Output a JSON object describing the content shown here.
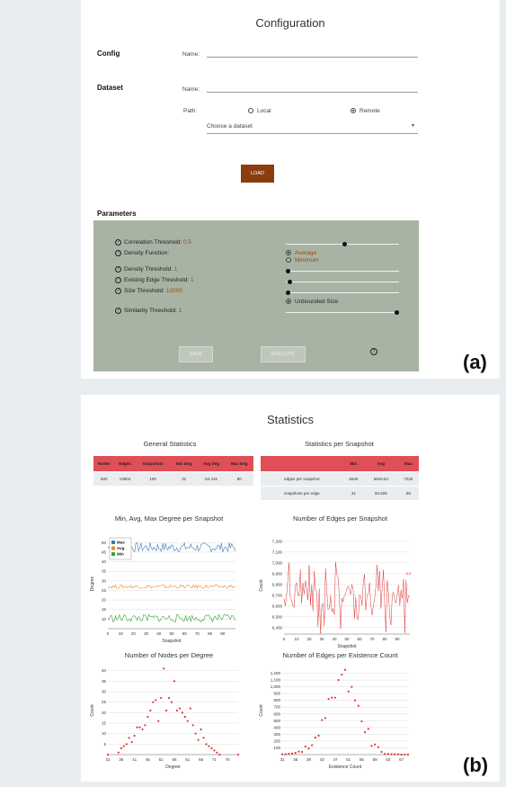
{
  "config": {
    "title": "Configuration",
    "config_label": "Config",
    "name_label": "Name:",
    "dataset_label": "Dataset",
    "dataset_name_label": "Name:",
    "path_label": "Path:",
    "local_label": "Local",
    "remote_label": "Remote",
    "dataset_select": "Choose a dataset",
    "load_label": "LOAD"
  },
  "parameters": {
    "title": "Parameters",
    "correlation_label": "Correlation Threshold: ",
    "correlation_value": "0.5",
    "density_fn_label": "Density Function:",
    "avg_label": "Average",
    "min_label": "Minimum",
    "density_label": "Density Threshold: ",
    "density_value": "1",
    "existing_label": "Existing Edge Threshold: ",
    "existing_value": "1",
    "size_label": "Size Threshold: ",
    "size_value": "10000",
    "unbounded_label": "Unbounded Size",
    "similarity_label": "Similarity Threshold: ",
    "similarity_value": "1",
    "save_label": "SAVE",
    "execute_label": "EXECUTE",
    "help_icon": "?",
    "correlation_slider": 0.52,
    "density_slider": 0.0,
    "existing_slider": 0.02,
    "size_slider": 0.0,
    "similarity_slider": 1.0
  },
  "labels": {
    "a": "(a)",
    "b": "(b)"
  },
  "stats": {
    "title": "Statistics",
    "general_title": "General Statistics",
    "snapshot_title": "Statistics per Snapshot",
    "general_headers": [
      "Nodes",
      "Edges",
      "Snapshots",
      "Min Deg",
      "Avg Deg",
      "Max Deg"
    ],
    "general_values": [
      "500",
      "13604",
      "100",
      "31",
      "54.416",
      "80"
    ],
    "snap_headers": [
      "",
      "Min",
      "Avg",
      "Max"
    ],
    "snap_rows": [
      [
        "edges per snapshot",
        "6845",
        "6843.54",
        "7226"
      ],
      [
        "snapshots per edge",
        "31",
        "50.505",
        "69"
      ]
    ]
  },
  "chart_data": [
    {
      "type": "line",
      "title": "Min, Avg, Max Degree per Snapshot",
      "xlabel": "Snapshot",
      "ylabel": "Degree",
      "xlim": [
        0,
        100
      ],
      "ylim": [
        5,
        52
      ],
      "xticks": [
        "0",
        "10",
        "20",
        "30",
        "40",
        "50",
        "60",
        "70",
        "80",
        "90"
      ],
      "yticks": [
        "10",
        "15",
        "20",
        "25",
        "30",
        "35",
        "40",
        "45",
        "50"
      ],
      "legend": "top-left",
      "colors": [
        "#3a78b5",
        "#ef8a2c",
        "#3aa23a"
      ],
      "series": [
        {
          "name": "Max",
          "base": 47.5,
          "amp": 2.5
        },
        {
          "name": "Avg",
          "base": 27,
          "amp": 1
        },
        {
          "name": "Min",
          "base": 10.5,
          "amp": 2
        }
      ]
    },
    {
      "type": "line",
      "title": "Number of Edges per Snapshot",
      "xlabel": "Snapshot",
      "ylabel": "Count",
      "xlim": [
        0,
        100
      ],
      "ylim": [
        6340,
        7240
      ],
      "xticks": [
        "0",
        "10",
        "20",
        "30",
        "40",
        "50",
        "60",
        "70",
        "80",
        "90"
      ],
      "yticks": [
        "6,400",
        "6,500",
        "6,600",
        "6,700",
        "6,800",
        "6,900",
        "7,000",
        "7,100",
        "7,200"
      ],
      "color": "#e03333",
      "annotation": "6,9"
    },
    {
      "type": "scatter",
      "title": "Number of Nodes per Degree",
      "xlabel": "Degree",
      "ylabel": "Count",
      "xlim": [
        31,
        80
      ],
      "ylim": [
        0,
        42
      ],
      "xticks": [
        "31",
        "36",
        "41",
        "46",
        "51",
        "56",
        "61",
        "66",
        "71",
        "76"
      ],
      "yticks": [
        "5",
        "10",
        "15",
        "20",
        "25",
        "30",
        "35",
        "40"
      ],
      "color": "#e03333",
      "x": [
        31,
        35,
        36,
        37,
        38,
        39,
        40,
        41,
        42,
        43,
        44,
        45,
        46,
        47,
        48,
        49,
        50,
        51,
        52,
        53,
        54,
        55,
        56,
        57,
        58,
        59,
        60,
        61,
        62,
        63,
        64,
        65,
        66,
        67,
        68,
        69,
        70,
        71,
        72,
        73,
        80
      ],
      "y": [
        0,
        1,
        3,
        4,
        5,
        8,
        6,
        9,
        13,
        13,
        12,
        14,
        18,
        21,
        25,
        26,
        16,
        27,
        41,
        21,
        27,
        25,
        35,
        21,
        22,
        20,
        18,
        16,
        22,
        14,
        10,
        7,
        12,
        8,
        5,
        4,
        3,
        2,
        1,
        0,
        0
      ]
    },
    {
      "type": "scatter",
      "title": "Number of Edges per Existence Count",
      "xlabel": "Existence Count",
      "ylabel": "Count",
      "xlim": [
        31,
        69
      ],
      "ylim": [
        0,
        1300
      ],
      "xticks": [
        "31",
        "35",
        "39",
        "43",
        "47",
        "51",
        "55",
        "59",
        "63",
        "67"
      ],
      "yticks": [
        "100",
        "200",
        "300",
        "400",
        "500",
        "600",
        "700",
        "800",
        "900",
        "1,000",
        "1,100",
        "1,200"
      ],
      "color": "#e03333",
      "x": [
        31,
        32,
        33,
        34,
        35,
        36,
        37,
        38,
        39,
        40,
        41,
        42,
        43,
        44,
        45,
        46,
        47,
        48,
        49,
        50,
        51,
        52,
        53,
        54,
        55,
        56,
        57,
        58,
        59,
        60,
        61,
        62,
        63,
        64,
        65,
        66,
        67,
        68,
        69
      ],
      "y": [
        5,
        5,
        10,
        15,
        25,
        45,
        40,
        120,
        90,
        140,
        250,
        280,
        510,
        540,
        820,
        840,
        840,
        1100,
        1180,
        1250,
        930,
        1000,
        800,
        720,
        490,
        330,
        380,
        130,
        150,
        110,
        40,
        10,
        10,
        5,
        5,
        5,
        0,
        0,
        0
      ]
    }
  ]
}
